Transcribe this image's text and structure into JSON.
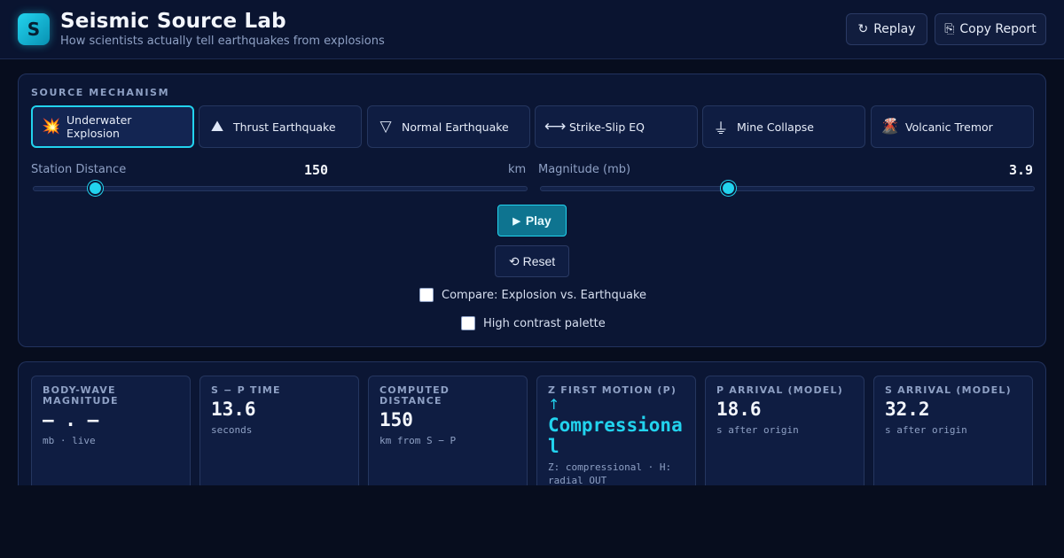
{
  "app": {
    "logo_letter": "S",
    "title": "Seismic Source Lab",
    "subtitle": "How scientists actually tell earthquakes from explosions"
  },
  "header_buttons": {
    "replay_icon": "↻",
    "replay_label": "Replay",
    "copy_icon": "⎘",
    "copy_label": "Copy Report"
  },
  "source": {
    "section_label": "SOURCE MECHANISM",
    "mechanisms": [
      {
        "icon": "💥",
        "icon_name": "explosion-icon",
        "label": "Underwater Explosion",
        "selected": true
      },
      {
        "icon": "⛰",
        "icon_name": "mountain-icon",
        "label": "Thrust Earthquake",
        "selected": false
      },
      {
        "icon": "▽",
        "icon_name": "triangle-down-icon",
        "label": "Normal Earthquake",
        "selected": false
      },
      {
        "icon": "⟷",
        "icon_name": "double-arrow-icon",
        "label": "Strike-Slip EQ",
        "selected": false
      },
      {
        "icon": "⏚",
        "icon_name": "ground-icon",
        "label": "Mine Collapse",
        "selected": false
      },
      {
        "icon": "🌋",
        "icon_name": "volcano-icon",
        "label": "Volcanic Tremor",
        "selected": false
      }
    ]
  },
  "sliders": {
    "distance": {
      "label": "Station Distance",
      "value": "150",
      "unit": "km",
      "fraction": 0.125
    },
    "magnitude": {
      "label": "Magnitude (mb)",
      "value": "3.9",
      "fraction": 0.38
    }
  },
  "controls": {
    "play_icon": "▶",
    "play_label": "Play",
    "reset_icon": "⟲",
    "reset_label": "Reset",
    "compare_label": "Compare: Explosion vs. Earthquake",
    "compare_checked": false,
    "contrast_label": "High contrast palette",
    "contrast_checked": false
  },
  "metrics": [
    {
      "label": "BODY-WAVE MAGNITUDE",
      "value": "— . —",
      "sub": "mb · live"
    },
    {
      "label": "S − P TIME",
      "value": "13.6",
      "sub": "seconds"
    },
    {
      "label": "COMPUTED DISTANCE",
      "value": "150",
      "sub": "km from S − P"
    },
    {
      "label": "Z FIRST MOTION (P)",
      "arrow": "↑",
      "value": "Compressional",
      "sub": "Z: compressional · H: radial OUT"
    },
    {
      "label": "P ARRIVAL (MODEL)",
      "value": "18.6",
      "sub": "s after origin"
    },
    {
      "label": "S ARRIVAL (MODEL)",
      "value": "32.2",
      "sub": "s after origin"
    }
  ],
  "colors": {
    "accent": "#22d3ee",
    "background": "#070d1e",
    "panel": "#0b1634"
  }
}
